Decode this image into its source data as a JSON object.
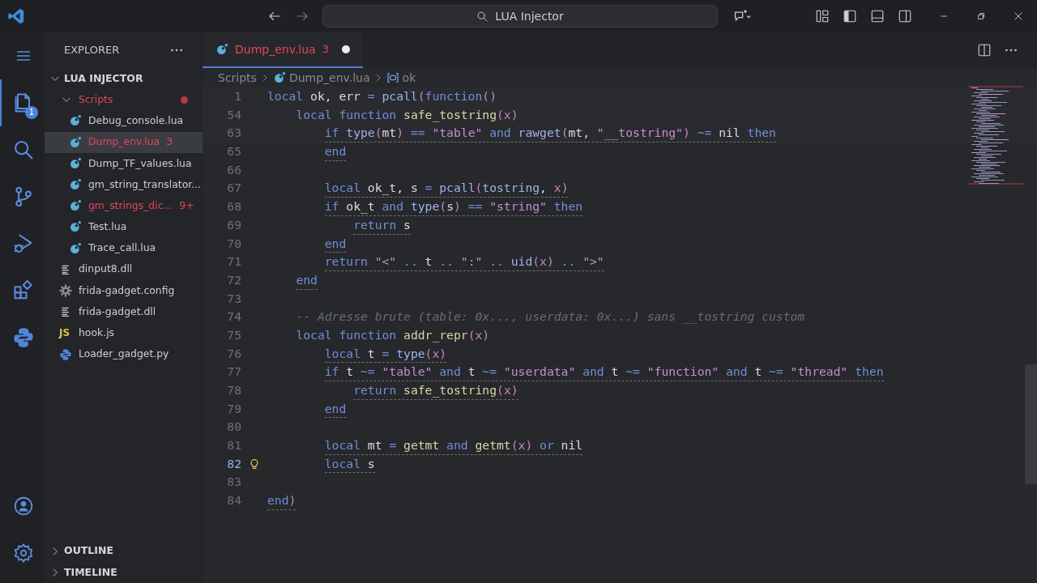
{
  "title_bar": {
    "search": "LUA Injector"
  },
  "activity_bar": {
    "items": [
      {
        "kind": "files",
        "selected": true,
        "badge": "1"
      },
      {
        "kind": "search",
        "selected": false
      },
      {
        "kind": "source-control",
        "selected": false
      },
      {
        "kind": "run-debug",
        "selected": false
      },
      {
        "kind": "extensions",
        "selected": false
      },
      {
        "kind": "python",
        "selected": false
      }
    ],
    "bottom": [
      {
        "kind": "account"
      },
      {
        "kind": "settings"
      }
    ]
  },
  "sidebar": {
    "title": "EXPLORER",
    "sections": [
      {
        "title": "LUA INJECTOR",
        "expanded": true,
        "children": [
          {
            "name": "Scripts",
            "kind": "folder",
            "expanded": true,
            "error": true,
            "selected": false,
            "children": [
              {
                "name": "Debug_console.lua",
                "kind": "lua",
                "error": false,
                "selected": false
              },
              {
                "name": "Dump_env.lua",
                "kind": "lua",
                "error": true,
                "badge": "3",
                "selected": true
              },
              {
                "name": "Dump_TF_values.lua",
                "kind": "lua",
                "error": false,
                "selected": false
              },
              {
                "name": "gm_string_translator...",
                "kind": "lua",
                "error": false,
                "selected": false
              },
              {
                "name": "gm_strings_dic...",
                "kind": "lua",
                "error": true,
                "badge": "9+",
                "selected": false
              },
              {
                "name": "Test.lua",
                "kind": "lua",
                "error": false,
                "selected": false
              },
              {
                "name": "Trace_call.lua",
                "kind": "lua",
                "error": false,
                "selected": false
              }
            ]
          },
          {
            "name": "dinput8.dll",
            "kind": "dll",
            "error": false,
            "selected": false
          },
          {
            "name": "frida-gadget.config",
            "kind": "config",
            "error": false,
            "selected": false
          },
          {
            "name": "frida-gadget.dll",
            "kind": "dll",
            "error": false,
            "selected": false
          },
          {
            "name": "hook.js",
            "kind": "js",
            "icon_text": "JS",
            "error": false,
            "selected": false
          },
          {
            "name": "Loader_gadget.py",
            "kind": "py",
            "error": false,
            "selected": false
          }
        ]
      }
    ],
    "panels": [
      {
        "title": "OUTLINE",
        "expanded": false
      },
      {
        "title": "TIMELINE",
        "expanded": false
      }
    ]
  },
  "tabs": [
    {
      "label": "Dump_env.lua",
      "badge": "3",
      "error": true,
      "modified": true,
      "selected": true
    }
  ],
  "breadcrumb": [
    {
      "kind": "folder",
      "text": "Scripts"
    },
    {
      "kind": "lua",
      "text": "Dump_env.lua"
    },
    {
      "kind": "variable",
      "text": "ok"
    }
  ],
  "sticky_lines": [
    {
      "number": "1",
      "tokens": [
        {
          "kind": "kw",
          "text": "local"
        },
        {
          "kind": "id",
          "text": " ok, err "
        },
        {
          "kind": "op",
          "text": "="
        },
        {
          "kind": "call",
          "text": " pcall"
        },
        {
          "kind": "punc",
          "text": "("
        },
        {
          "kind": "kw",
          "text": "function"
        },
        {
          "kind": "punc",
          "text": "()"
        }
      ]
    },
    {
      "number": "54",
      "tokens": [
        {
          "kind": "kw",
          "text": "    local"
        },
        {
          "kind": "kw",
          "text": " function"
        },
        {
          "kind": "fn",
          "text": " safe_tostring"
        },
        {
          "kind": "punc",
          "text": "("
        },
        {
          "kind": "param",
          "text": "x"
        },
        {
          "kind": "punc",
          "text": ")"
        }
      ]
    },
    {
      "number": "63",
      "underlined": true,
      "tokens": [
        {
          "kind": "kw",
          "text": "        if"
        },
        {
          "kind": "call",
          "text": " type"
        },
        {
          "kind": "punc",
          "text": "("
        },
        {
          "kind": "id",
          "text": "mt"
        },
        {
          "kind": "punc",
          "text": ")"
        },
        {
          "kind": "op",
          "text": " =="
        },
        {
          "kind": "str",
          "text": " \"table\""
        },
        {
          "kind": "kw",
          "text": " and"
        },
        {
          "kind": "call",
          "text": " rawget"
        },
        {
          "kind": "punc",
          "text": "("
        },
        {
          "kind": "id",
          "text": "mt, "
        },
        {
          "kind": "str",
          "text": "\"__tostring\""
        },
        {
          "kind": "punc",
          "text": ")"
        },
        {
          "kind": "op",
          "text": " ~="
        },
        {
          "kind": "id",
          "text": " nil"
        },
        {
          "kind": "kw",
          "text": " then"
        }
      ]
    }
  ],
  "lines": [
    {
      "number": "65",
      "underlined": true,
      "tokens": [
        {
          "kind": "kw",
          "text": "        end"
        }
      ]
    },
    {
      "number": "66"
    },
    {
      "number": "67",
      "underlined": true,
      "tokens": [
        {
          "kind": "kw",
          "text": "        local"
        },
        {
          "kind": "id",
          "text": " ok_t, s "
        },
        {
          "kind": "op",
          "text": "="
        },
        {
          "kind": "call",
          "text": " pcall"
        },
        {
          "kind": "punc",
          "text": "("
        },
        {
          "kind": "call",
          "text": "tostring"
        },
        {
          "kind": "id",
          "text": ", "
        },
        {
          "kind": "param",
          "text": "x"
        },
        {
          "kind": "punc",
          "text": ")"
        }
      ]
    },
    {
      "number": "68",
      "underlined": true,
      "tokens": [
        {
          "kind": "kw",
          "text": "        if"
        },
        {
          "kind": "id",
          "text": " ok_t"
        },
        {
          "kind": "kw",
          "text": " and"
        },
        {
          "kind": "call",
          "text": " type"
        },
        {
          "kind": "punc",
          "text": "("
        },
        {
          "kind": "id",
          "text": "s"
        },
        {
          "kind": "punc",
          "text": ")"
        },
        {
          "kind": "op",
          "text": " =="
        },
        {
          "kind": "str",
          "text": " \"string\""
        },
        {
          "kind": "kw",
          "text": " then"
        }
      ]
    },
    {
      "number": "69",
      "underlined": true,
      "tokens": [
        {
          "kind": "kw",
          "text": "            return"
        },
        {
          "kind": "id",
          "text": " s"
        }
      ]
    },
    {
      "number": "70",
      "underlined": true,
      "tokens": [
        {
          "kind": "kw",
          "text": "        end"
        }
      ]
    },
    {
      "number": "71",
      "underlined": true,
      "tokens": [
        {
          "kind": "kw",
          "text": "        return"
        },
        {
          "kind": "str",
          "text": " \"<\""
        },
        {
          "kind": "op",
          "text": " .."
        },
        {
          "kind": "id",
          "text": " t"
        },
        {
          "kind": "op",
          "text": " .."
        },
        {
          "kind": "str",
          "text": " \":\""
        },
        {
          "kind": "op",
          "text": " .."
        },
        {
          "kind": "call",
          "text": " uid"
        },
        {
          "kind": "punc",
          "text": "("
        },
        {
          "kind": "param",
          "text": "x"
        },
        {
          "kind": "punc",
          "text": ")"
        },
        {
          "kind": "op",
          "text": " .."
        },
        {
          "kind": "str",
          "text": " \">\""
        }
      ]
    },
    {
      "number": "72",
      "underlined": true,
      "tokens": [
        {
          "kind": "kw",
          "text": "    end"
        }
      ]
    },
    {
      "number": "73"
    },
    {
      "number": "74",
      "underlined": false,
      "tokens": [
        {
          "kind": "comment",
          "text": "    -- Adresse brute (table: 0x..., userdata: 0x...) sans __tostring custom"
        }
      ]
    },
    {
      "number": "75",
      "underlined": false,
      "tokens": [
        {
          "kind": "kw",
          "text": "    local"
        },
        {
          "kind": "kw",
          "text": " function"
        },
        {
          "kind": "fn",
          "text": " addr_repr"
        },
        {
          "kind": "punc",
          "text": "("
        },
        {
          "kind": "param",
          "text": "x"
        },
        {
          "kind": "punc",
          "text": ")"
        }
      ]
    },
    {
      "number": "76",
      "underlined": true,
      "tokens": [
        {
          "kind": "kw",
          "text": "        local"
        },
        {
          "kind": "id",
          "text": " t "
        },
        {
          "kind": "op",
          "text": "="
        },
        {
          "kind": "call",
          "text": " type"
        },
        {
          "kind": "punc",
          "text": "("
        },
        {
          "kind": "param",
          "text": "x"
        },
        {
          "kind": "punc",
          "text": ")"
        }
      ]
    },
    {
      "number": "77",
      "underlined": true,
      "tokens": [
        {
          "kind": "kw",
          "text": "        if"
        },
        {
          "kind": "id",
          "text": " t"
        },
        {
          "kind": "op",
          "text": " ~="
        },
        {
          "kind": "str",
          "text": " \"table\""
        },
        {
          "kind": "kw",
          "text": " and"
        },
        {
          "kind": "id",
          "text": " t"
        },
        {
          "kind": "op",
          "text": " ~="
        },
        {
          "kind": "str",
          "text": " \"userdata\""
        },
        {
          "kind": "kw",
          "text": " and"
        },
        {
          "kind": "id",
          "text": " t"
        },
        {
          "kind": "op",
          "text": " ~="
        },
        {
          "kind": "str",
          "text": " \"function\""
        },
        {
          "kind": "kw",
          "text": " and"
        },
        {
          "kind": "id",
          "text": " t"
        },
        {
          "kind": "op",
          "text": " ~="
        },
        {
          "kind": "str",
          "text": " \"thread\""
        },
        {
          "kind": "kw",
          "text": " then"
        }
      ]
    },
    {
      "number": "78",
      "underlined": true,
      "tokens": [
        {
          "kind": "kw",
          "text": "            return"
        },
        {
          "kind": "fn",
          "text": " safe_tostring"
        },
        {
          "kind": "punc",
          "text": "("
        },
        {
          "kind": "param",
          "text": "x"
        },
        {
          "kind": "punc",
          "text": ")"
        }
      ]
    },
    {
      "number": "79",
      "underlined": true,
      "tokens": [
        {
          "kind": "kw",
          "text": "        end"
        }
      ]
    },
    {
      "number": "80"
    },
    {
      "number": "81",
      "underlined": true,
      "tokens": [
        {
          "kind": "kw",
          "text": "        local"
        },
        {
          "kind": "id",
          "text": " mt "
        },
        {
          "kind": "op",
          "text": "="
        },
        {
          "kind": "fn",
          "text": " getmt"
        },
        {
          "kind": "kw",
          "text": " and"
        },
        {
          "kind": "fn",
          "text": " getmt"
        },
        {
          "kind": "punc",
          "text": "("
        },
        {
          "kind": "param",
          "text": "x"
        },
        {
          "kind": "punc",
          "text": ")"
        },
        {
          "kind": "kw",
          "text": " or"
        },
        {
          "kind": "id",
          "text": " nil"
        }
      ]
    },
    {
      "number": "82",
      "underlined": true,
      "current": true,
      "lightbulb": true,
      "tokens": [
        {
          "kind": "kw",
          "text": "        local"
        },
        {
          "kind": "id",
          "text": " s"
        }
      ]
    },
    {
      "number": "83"
    },
    {
      "number": "84",
      "underlined": true,
      "tokens": [
        {
          "kind": "kw",
          "text": "end"
        },
        {
          "kind": "punc",
          "text": ")"
        }
      ]
    }
  ]
}
